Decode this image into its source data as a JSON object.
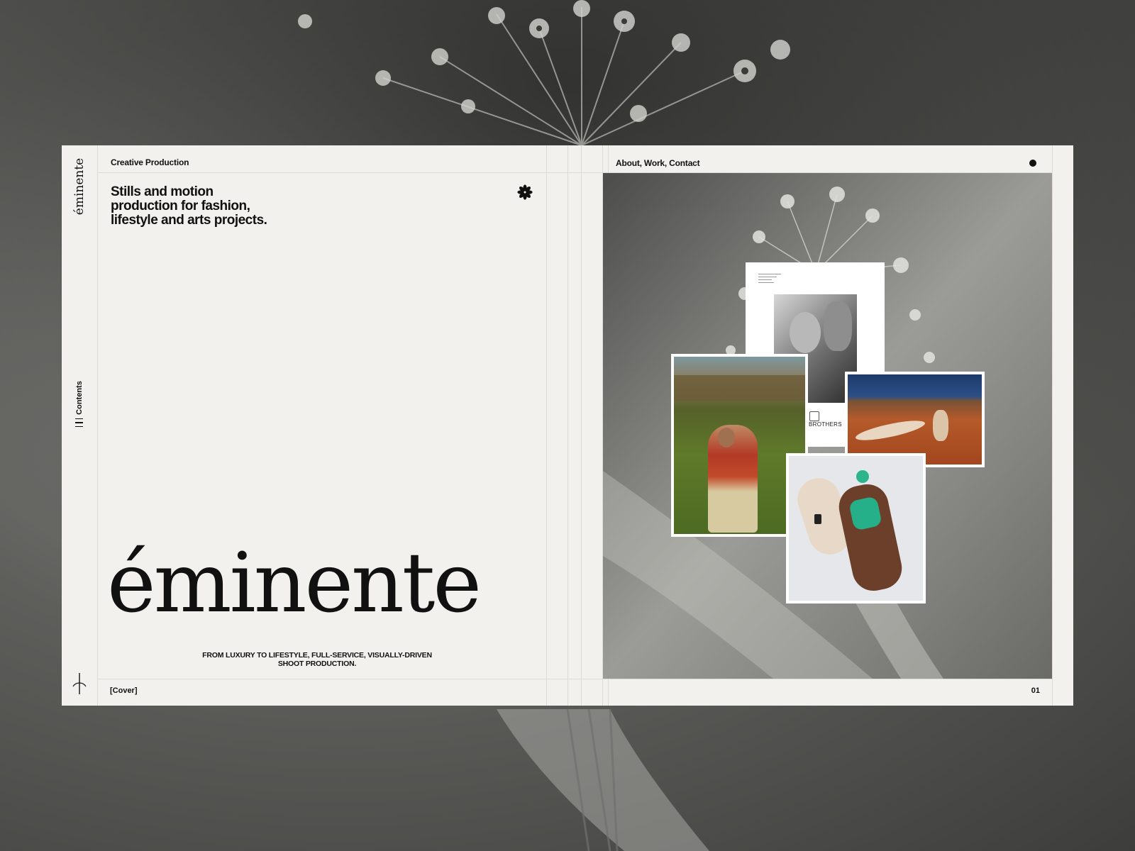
{
  "left_page": {
    "rail_logo": "éminente",
    "rail_contents": "Contents",
    "header_label": "Creative Production",
    "tagline": "Stills and motion production for fashion, lifestyle and arts projects.",
    "wordmark": "éminente",
    "subline": "FROM LUXURY TO LIFESTYLE, FULL-SERVICE, VISUALLY-DRIVEN SHOOT PRODUCTION.",
    "footer_label": "[Cover]"
  },
  "right_page": {
    "nav_label": "About, Work, Contact",
    "page_number": "01",
    "collage": {
      "brothers_label": "BROTHERS"
    }
  },
  "icons": {
    "rail_menu": "menu-lines-icon",
    "rail_bottom": "sprig-icon",
    "header_mark": "asterisk-flower-icon",
    "header_dot": "dot-icon"
  },
  "colors": {
    "paper": "#f2f1ee",
    "ink": "#111111",
    "rule": "#dcdbd7"
  }
}
